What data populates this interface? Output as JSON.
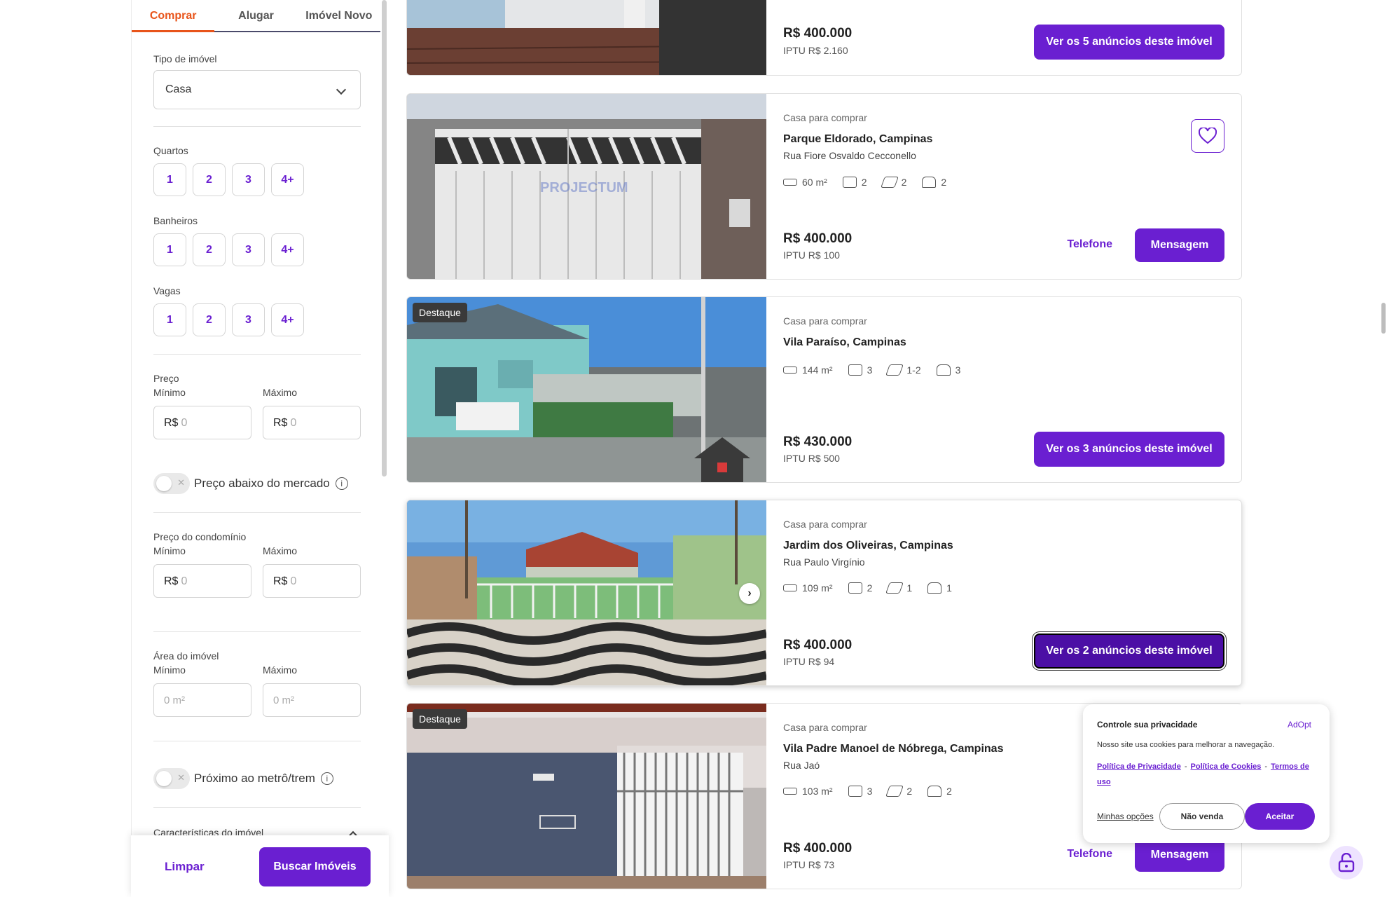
{
  "sidebar": {
    "tabs": [
      {
        "label": "Comprar"
      },
      {
        "label": "Alugar"
      },
      {
        "label": "Imóvel Novo"
      }
    ],
    "tipo_label": "Tipo de imóvel",
    "tipo_value": "Casa",
    "quartos_label": "Quartos",
    "banheiros_label": "Banheiros",
    "vagas_label": "Vagas",
    "chip_options": [
      "1",
      "2",
      "3",
      "4+"
    ],
    "preco_label": "Preço",
    "minimo_label": "Mínimo",
    "maximo_label": "Máximo",
    "currency": "R$",
    "money_placeholder": "0",
    "below_market_label": "Preço abaixo do mercado",
    "condominio_label": "Preço do condomínio",
    "area_label": "Área do imóvel",
    "area_placeholder": "0 m²",
    "metro_label": "Próximo ao metrô/trem",
    "caracteristicas_label": "Características do imóvel",
    "clear_label": "Limpar",
    "search_label": "Buscar Imóveis"
  },
  "listings": [
    {
      "price": "R$ 400.000",
      "iptu": "IPTU R$ 2.160",
      "action": "Ver os 5 anúncios deste imóvel"
    },
    {
      "type": "Casa para comprar",
      "title": "Parque Eldorado, Campinas",
      "street": "Rua Fiore Osvaldo Cecconello",
      "area": "60 m²",
      "bedrooms": "2",
      "bathrooms": "2",
      "parking": "2",
      "price": "R$ 400.000",
      "iptu": "IPTU R$ 100",
      "phone_label": "Telefone",
      "message_label": "Mensagem",
      "watermark": "PROJECTUM"
    },
    {
      "badge": "Destaque",
      "type": "Casa para comprar",
      "title": "Vila Paraíso, Campinas",
      "area": "144 m²",
      "bedrooms": "3",
      "bathrooms": "1-2",
      "parking": "3",
      "price": "R$ 430.000",
      "iptu": "IPTU R$ 500",
      "action": "Ver os 3 anúncios deste imóvel"
    },
    {
      "type": "Casa para comprar",
      "title": "Jardim dos Oliveiras, Campinas",
      "street": "Rua Paulo Virgínio",
      "area": "109 m²",
      "bedrooms": "2",
      "bathrooms": "1",
      "parking": "1",
      "price": "R$ 400.000",
      "iptu": "IPTU R$ 94",
      "action": "Ver os 2 anúncios deste imóvel"
    },
    {
      "badge": "Destaque",
      "type": "Casa para comprar",
      "title": "Vila Padre Manoel de Nóbrega, Campinas",
      "street": "Rua Jaó",
      "area": "103 m²",
      "bedrooms": "3",
      "bathrooms": "2",
      "parking": "2",
      "price": "R$ 400.000",
      "iptu": "IPTU R$ 73",
      "phone_label": "Telefone",
      "message_label": "Mensagem"
    }
  ],
  "cookie": {
    "title": "Controle sua privacidade",
    "brand": "AdOpt",
    "text": "Nosso site usa cookies para melhorar a navegação.",
    "link_privacy": "Política de Privacidade",
    "link_cookies": "Política de Cookies",
    "link_terms": "Termos de uso",
    "options": "Minhas opções",
    "no_sale": "Não venda",
    "accept": "Aceitar"
  },
  "colors": {
    "accent": "#6a1fd1",
    "tab_active": "#e8541a"
  }
}
